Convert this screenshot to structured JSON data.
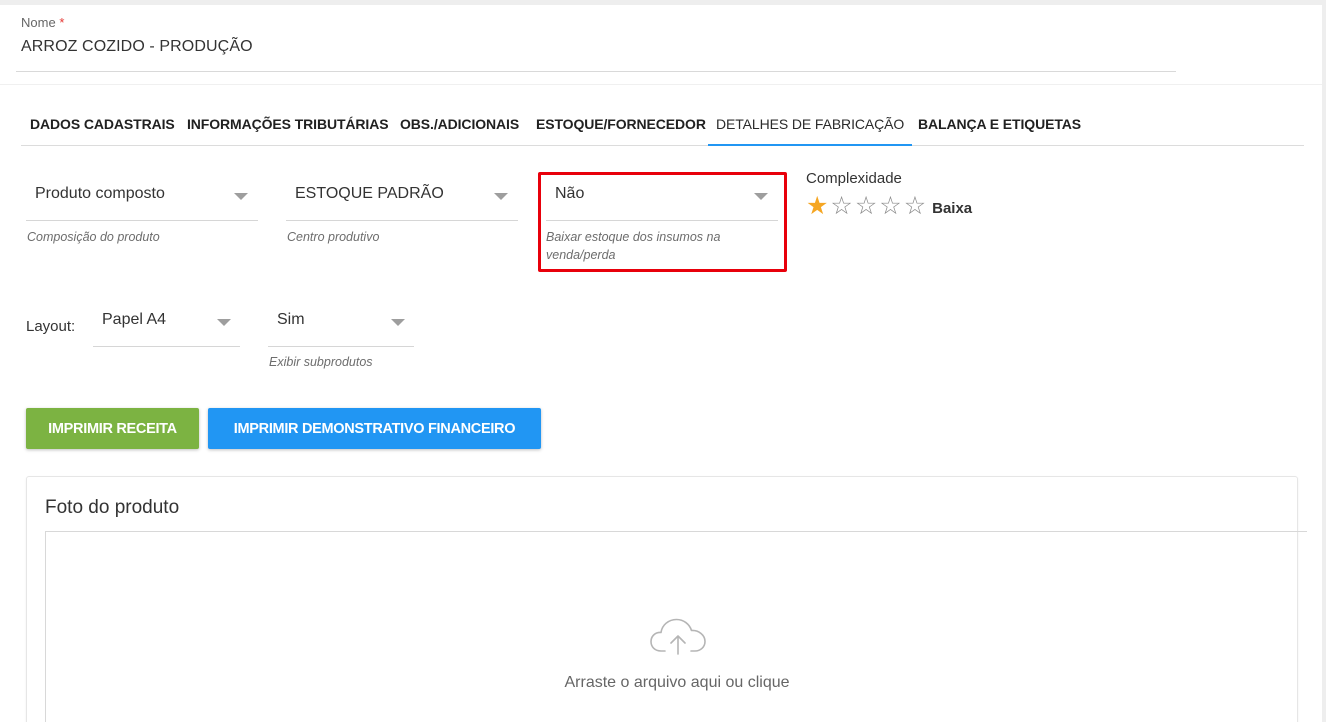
{
  "name_field": {
    "label": "Nome",
    "required_mark": "*",
    "value": "ARROZ COZIDO - PRODUÇÃO"
  },
  "tabs": [
    {
      "label": "DADOS CADASTRAIS",
      "active": false
    },
    {
      "label": "INFORMAÇÕES TRIBUTÁRIAS",
      "active": false
    },
    {
      "label": "OBS./ADICIONAIS",
      "active": false
    },
    {
      "label": "ESTOQUE/FORNECEDOR",
      "active": false
    },
    {
      "label": "DETALHES DE FABRICAÇÃO",
      "active": true
    },
    {
      "label": "BALANÇA E ETIQUETAS",
      "active": false
    }
  ],
  "fields": {
    "composition": {
      "value": "Produto composto",
      "hint": "Composição do produto"
    },
    "production_center": {
      "value": "ESTOQUE PADRÃO",
      "hint": "Centro produtivo"
    },
    "lower_stock": {
      "value": "Não",
      "hint": "Baixar estoque dos insumos na venda/perda"
    }
  },
  "complexity": {
    "label": "Complexidade",
    "rating": 1,
    "max": 5,
    "value_label": "Baixa"
  },
  "layout": {
    "label": "Layout:",
    "paper": {
      "value": "Papel A4"
    },
    "subproducts": {
      "value": "Sim",
      "hint": "Exibir subprodutos"
    }
  },
  "buttons": {
    "print_recipe": "IMPRIMIR RECEITA",
    "print_financial": "IMPRIMIR DEMONSTRATIVO FINANCEIRO"
  },
  "photo": {
    "title": "Foto do produto",
    "dropzone_text": "Arraste o arquivo aqui ou clique"
  },
  "colors": {
    "accent": "#2196f3",
    "success": "#7cb342",
    "highlight": "#e8000b",
    "star": "#f5a623"
  }
}
